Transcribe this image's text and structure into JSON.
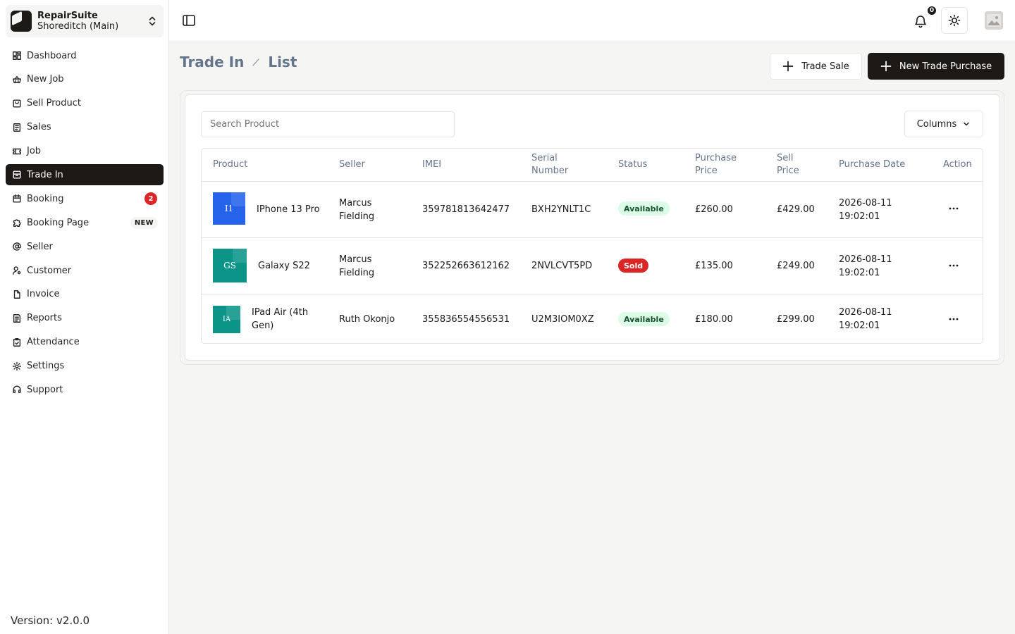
{
  "store": {
    "name": "RepairSuite",
    "branch": "Shoreditch (Main)"
  },
  "nav": {
    "items": [
      {
        "label": "Dashboard",
        "icon": "dashboard-icon"
      },
      {
        "label": "New Job",
        "icon": "basket-icon"
      },
      {
        "label": "Sell Product",
        "icon": "shopping-bag-icon"
      },
      {
        "label": "Sales",
        "icon": "receipt-icon"
      },
      {
        "label": "Job",
        "icon": "ticket-icon"
      },
      {
        "label": "Trade In",
        "icon": "archive-icon",
        "active": true
      },
      {
        "label": "Booking",
        "icon": "calendar-icon",
        "badge": "2"
      },
      {
        "label": "Booking Page",
        "icon": "puzzle-icon",
        "tag": "NEW"
      },
      {
        "label": "Seller",
        "icon": "at-sign-icon"
      },
      {
        "label": "Customer",
        "icon": "user-cog-icon"
      },
      {
        "label": "Invoice",
        "icon": "file-icon"
      },
      {
        "label": "Reports",
        "icon": "report-icon"
      },
      {
        "label": "Attendance",
        "icon": "clipboard-check-icon"
      },
      {
        "label": "Settings",
        "icon": "gear-icon"
      },
      {
        "label": "Support",
        "icon": "headset-icon"
      }
    ],
    "version": "Version: v2.0.0"
  },
  "header": {
    "notification_count": "0"
  },
  "page": {
    "breadcrumb": [
      "Trade In",
      "List"
    ],
    "trade_sale_label": "Trade Sale",
    "new_trade_purchase_label": "New Trade Purchase"
  },
  "search": {
    "placeholder": "Search Product",
    "value": ""
  },
  "columns_button": "Columns",
  "table": {
    "headers": [
      "Product",
      "Seller",
      "IMEI",
      "Serial Number",
      "Status",
      "Purchase Price",
      "Sell Price",
      "Purchase Date",
      "Action"
    ],
    "rows": [
      {
        "thumb_text": "I1",
        "thumb_color": "#2563eb",
        "product": "IPhone 13 Pro",
        "seller": "Marcus Fielding",
        "imei": "359781813642477",
        "serial": "BXH2YNLT1C",
        "status": "Available",
        "purchase_price": "£260.00",
        "sell_price": "£429.00",
        "purchase_date": "2026-08-11 19:02:01"
      },
      {
        "thumb_text": "GS",
        "thumb_color": "#0d9488",
        "product": "Galaxy S22",
        "seller": "Marcus Fielding",
        "imei": "352252663612162",
        "serial": "2NVLCVT5PD",
        "status": "Sold",
        "purchase_price": "£135.00",
        "sell_price": "£249.00",
        "purchase_date": "2026-08-11 19:02:01"
      },
      {
        "thumb_text": "IA",
        "thumb_color": "#0d9488",
        "product": "IPad Air (4th Gen)",
        "seller": "Ruth Okonjo",
        "imei": "355836554556531",
        "serial": "U2M3IOM0XZ",
        "status": "Available",
        "purchase_price": "£180.00",
        "sell_price": "£299.00",
        "purchase_date": "2026-08-11 19:02:01"
      }
    ]
  },
  "colors": {
    "primary": "#1c1917",
    "danger": "#dc2626",
    "success_bg": "#dcfce7",
    "muted": "#64748b"
  }
}
